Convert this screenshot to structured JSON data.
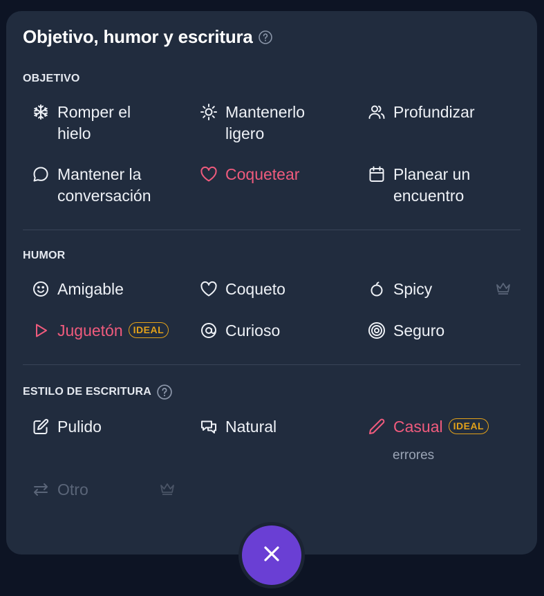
{
  "header": {
    "title": "Objetivo, humor y escritura",
    "help_icon": "help-circle-icon"
  },
  "objetivo": {
    "label": "OBJETIVO",
    "items": [
      {
        "line1": "Romper el",
        "line2": "hielo",
        "icon": "snowflake-icon",
        "active": false
      },
      {
        "line1": "Mantenerlo",
        "line2": "ligero",
        "icon": "sun-icon",
        "active": false
      },
      {
        "line1": "Profundizar",
        "line2": "",
        "icon": "users-icon",
        "active": false
      },
      {
        "line1": "Mantener la",
        "line2": "conversación",
        "icon": "chat-bubble-icon",
        "active": false
      },
      {
        "line1": "Coquetear",
        "line2": "",
        "icon": "heart-icon",
        "active": true
      },
      {
        "line1": "Planear un",
        "line2": "encuentro",
        "icon": "calendar-icon",
        "active": false
      }
    ]
  },
  "humor": {
    "label": "HUMOR",
    "items": [
      {
        "label": "Amigable",
        "icon": "smile-icon"
      },
      {
        "label": "Coqueto",
        "icon": "heart-outline-icon"
      },
      {
        "label": "Spicy",
        "icon": "pepper-icon",
        "premium": true
      },
      {
        "label": "Juguetón",
        "icon": "play-icon",
        "active": true,
        "badge": "IDEAL"
      },
      {
        "label": "Curioso",
        "icon": "at-target-icon"
      },
      {
        "label": "Seguro",
        "icon": "target-icon"
      }
    ]
  },
  "estilo": {
    "label": "ESTILO DE ESCRITURA",
    "items": [
      {
        "label": "Pulido",
        "icon": "edit-icon"
      },
      {
        "label": "Natural",
        "icon": "chat-bubbles-icon"
      },
      {
        "label": "Casual",
        "icon": "pencil-icon",
        "active": true,
        "badge": "IDEAL",
        "sub": "errores"
      },
      {
        "label": "Otro",
        "icon": "swap-arrows-icon",
        "disabled": true,
        "premium": true
      }
    ]
  },
  "close_button": {
    "icon": "close-icon"
  },
  "colors": {
    "accent": "#f05b7d",
    "badge": "#e3a21a",
    "panel": "#212c3e",
    "close": "#6a3fd4"
  }
}
